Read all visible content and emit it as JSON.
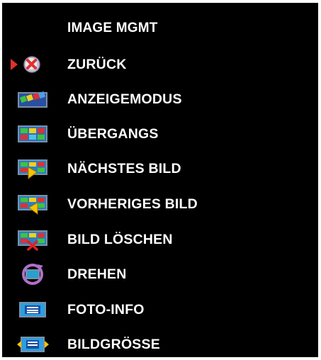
{
  "menu": {
    "title": "IMAGE MGMT",
    "selected_index": 0,
    "items": [
      {
        "label": "ZURÜCK",
        "icon": "back-x-icon"
      },
      {
        "label": "ANZEIGEMODUS",
        "icon": "display-mode-icon"
      },
      {
        "label": "ÜBERGANGS",
        "icon": "transition-icon"
      },
      {
        "label": "NÄCHSTES BILD",
        "icon": "next-image-icon"
      },
      {
        "label": "VORHERIGES BILD",
        "icon": "previous-image-icon"
      },
      {
        "label": "BILD LÖSCHEN",
        "icon": "delete-image-icon"
      },
      {
        "label": "DREHEN",
        "icon": "rotate-icon"
      },
      {
        "label": "FOTO-INFO",
        "icon": "photo-info-icon"
      },
      {
        "label": "BILDGRÖSSE",
        "icon": "image-size-icon"
      }
    ]
  },
  "colors": {
    "background": "#000000",
    "text": "#ffffff",
    "selection_arrow": "#e0312a"
  }
}
